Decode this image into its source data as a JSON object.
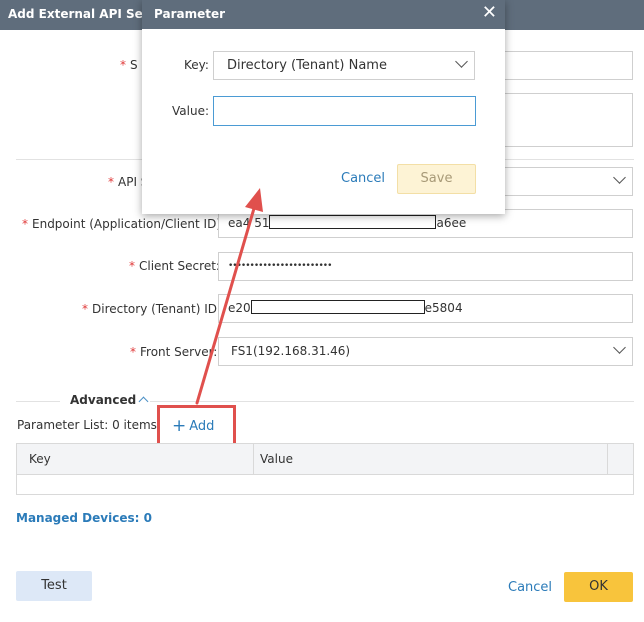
{
  "background_dialog": {
    "title": "Add External API Server",
    "fields": {
      "top_label_visible": "S",
      "api_label_visible": "API S",
      "endpoint_label": "Endpoint (Application/Client ID):",
      "endpoint_value_start": "ea4",
      "endpoint_value_mid": "51",
      "endpoint_value_end": "a6ee",
      "client_secret_label": "Client Secret:",
      "client_secret_value": "••••••••••••••••••••••••",
      "directory_label": "Directory (Tenant) ID:",
      "directory_value_start": "e20",
      "directory_value_end": "e5804",
      "front_server_label": "Front Server:",
      "front_server_value": "FS1(192.168.31.46)"
    },
    "advanced_label": "Advanced",
    "parameter_list_label": "Parameter List: 0 items",
    "add_label": "Add",
    "table": {
      "columns": [
        "Key",
        "Value"
      ]
    },
    "managed_devices_label": "Managed Devices: 0",
    "test_label": "Test",
    "cancel_label": "Cancel",
    "ok_label": "OK"
  },
  "modal": {
    "title": "Parameter",
    "key_label": "Key:",
    "key_value": "Directory (Tenant) Name",
    "value_label": "Value:",
    "value_input": "",
    "cancel_label": "Cancel",
    "save_label": "Save"
  },
  "colors": {
    "header_bg": "#5f6d7c",
    "link_blue": "#2b7bb9",
    "required_red": "#e03a3a",
    "ok_yellow": "#f8c43c",
    "annotation_red": "#e0504d"
  },
  "icons": [
    "close-icon",
    "chevron-down-icon",
    "chevron-up-icon",
    "plus-icon",
    "annotation-arrow"
  ]
}
